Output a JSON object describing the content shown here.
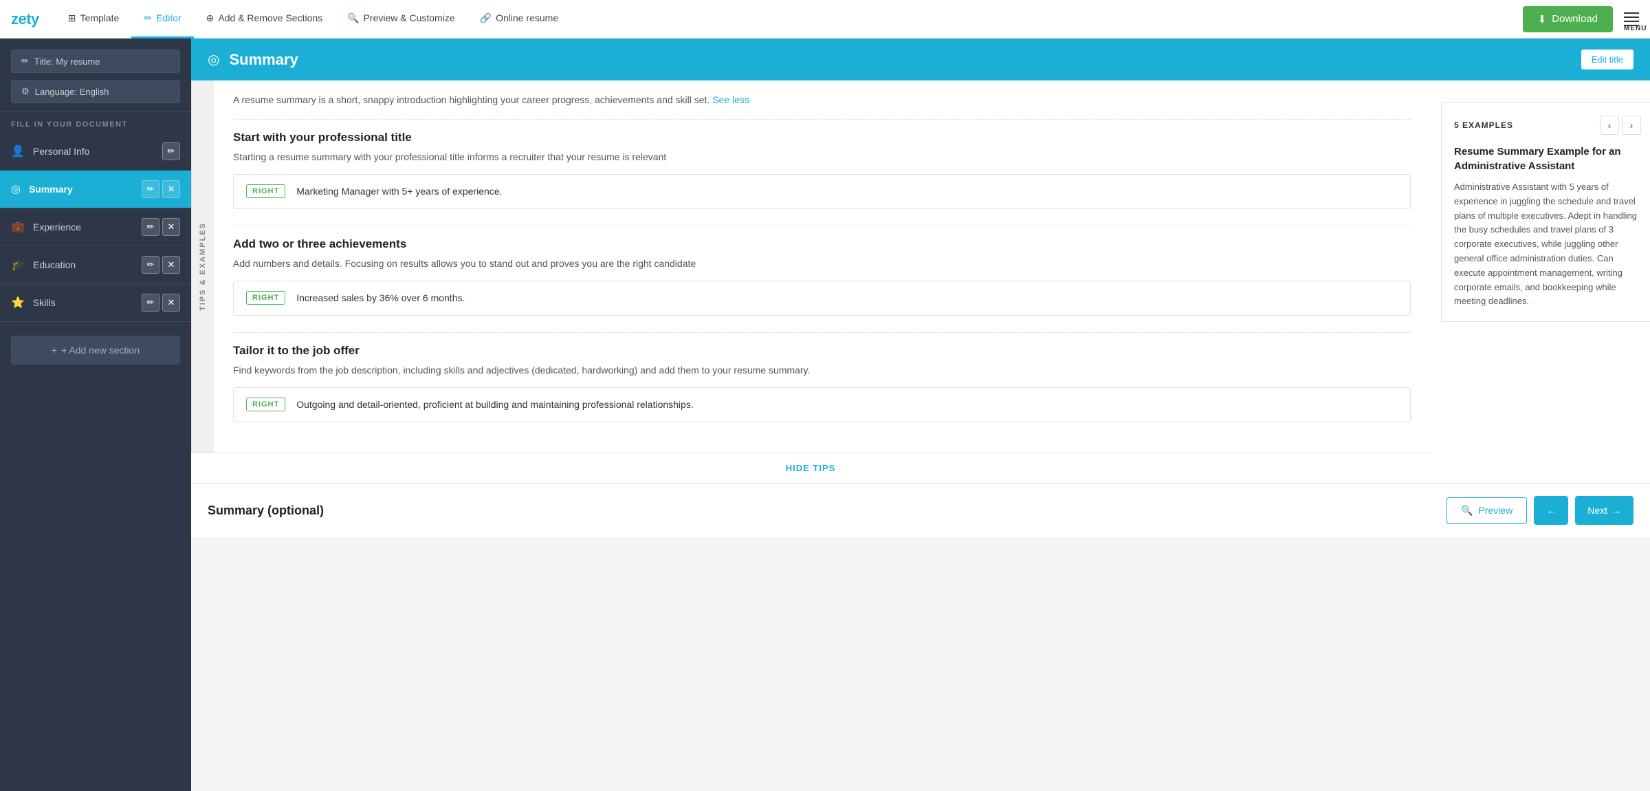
{
  "brand": "zety",
  "topnav": {
    "items": [
      {
        "id": "template",
        "label": "Template",
        "icon": "⊞",
        "active": false
      },
      {
        "id": "editor",
        "label": "Editor",
        "icon": "✏",
        "active": true
      },
      {
        "id": "add-remove",
        "label": "Add & Remove Sections",
        "icon": "⊕",
        "active": false
      },
      {
        "id": "preview",
        "label": "Preview & Customize",
        "icon": "🔍",
        "active": false
      },
      {
        "id": "online",
        "label": "Online resume",
        "icon": "🔗",
        "active": false
      }
    ],
    "download_label": "Download",
    "menu_label": "MENU"
  },
  "sidebar": {
    "title_btn": "Title: My resume",
    "language_btn": "Language: English",
    "fill_label": "FILL IN YOUR DOCUMENT",
    "items": [
      {
        "id": "personal-info",
        "label": "Personal Info",
        "icon": "👤",
        "active": false,
        "has_actions": true
      },
      {
        "id": "summary",
        "label": "Summary",
        "icon": "◎",
        "active": true,
        "has_actions": true
      },
      {
        "id": "experience",
        "label": "Experience",
        "icon": "💼",
        "active": false,
        "has_actions": true
      },
      {
        "id": "education",
        "label": "Education",
        "icon": "🎓",
        "active": false,
        "has_actions": true
      },
      {
        "id": "skills",
        "label": "Skills",
        "icon": "⭐",
        "active": false,
        "has_actions": true
      }
    ],
    "add_section_label": "+ Add new section"
  },
  "section": {
    "icon": "◎",
    "title": "Summary",
    "edit_title_label": "Edit title"
  },
  "tips_label": "TIPS & EXAMPLES",
  "intro": {
    "text": "A resume summary is a short, snappy introduction highlighting your career progress, achievements and skill set.",
    "link_text": "See less"
  },
  "tips": [
    {
      "id": "tip-1",
      "title": "Start with your professional title",
      "desc": "Starting a resume summary with your professional title informs a recruiter that your resume is relevant",
      "badge": "RIGHT",
      "example": "Marketing Manager with 5+ years of experience."
    },
    {
      "id": "tip-2",
      "title": "Add two or three achievements",
      "desc": "Add numbers and details. Focusing on results allows you to stand out and proves you are the right candidate",
      "badge": "RIGHT",
      "example": "Increased sales by 36% over 6 months."
    },
    {
      "id": "tip-3",
      "title": "Tailor it to the job offer",
      "desc": "Find keywords from the job description, including skills and adjectives (dedicated, hardworking) and add them to your resume summary.",
      "badge": "RIGHT",
      "example": "Outgoing and detail-oriented, proficient at building and maintaining professional relationships."
    }
  ],
  "hide_tips_label": "HIDE TIPS",
  "examples": {
    "count_label": "5 EXAMPLES",
    "title": "Resume Summary Example for an Administrative Assistant",
    "body": "Administrative Assistant with 5 years of experience in juggling the schedule and travel plans of multiple executives. Adept in handling the busy schedules and travel plans of 3 corporate executives, while juggling other general office administration duties. Can execute appointment management, writing corporate emails, and bookkeeping while meeting deadlines."
  },
  "summary_optional": {
    "title": "Summary (optional)"
  },
  "footer": {
    "preview_label": "Preview",
    "back_icon": "←",
    "next_label": "Next",
    "next_icon": "→"
  }
}
